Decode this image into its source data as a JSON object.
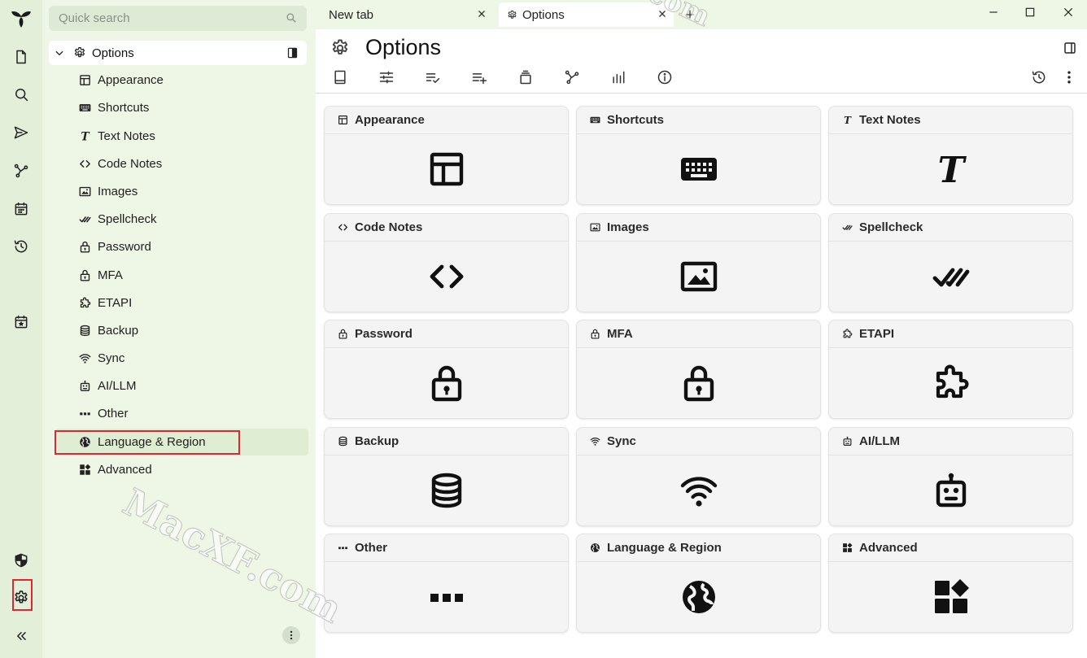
{
  "search": {
    "placeholder": "Quick search"
  },
  "tree": {
    "root_label": "Options",
    "items": [
      {
        "label": "Appearance",
        "icon": "layout-icon"
      },
      {
        "label": "Shortcuts",
        "icon": "keyboard-icon"
      },
      {
        "label": "Text Notes",
        "icon": "text-icon"
      },
      {
        "label": "Code Notes",
        "icon": "code-icon"
      },
      {
        "label": "Images",
        "icon": "image-icon"
      },
      {
        "label": "Spellcheck",
        "icon": "check-double-icon"
      },
      {
        "label": "Password",
        "icon": "lock-icon"
      },
      {
        "label": "MFA",
        "icon": "lock-icon"
      },
      {
        "label": "ETAPI",
        "icon": "puzzle-icon"
      },
      {
        "label": "Backup",
        "icon": "database-icon"
      },
      {
        "label": "Sync",
        "icon": "wifi-icon"
      },
      {
        "label": "AI/LLM",
        "icon": "robot-icon"
      },
      {
        "label": "Other",
        "icon": "dots-icon"
      },
      {
        "label": "Language & Region",
        "icon": "globe-icon"
      },
      {
        "label": "Advanced",
        "icon": "widgets-icon"
      }
    ]
  },
  "tabs": [
    {
      "label": "New tab"
    },
    {
      "label": "Options"
    }
  ],
  "page": {
    "title": "Options"
  },
  "cards": [
    {
      "label": "Appearance",
      "icon": "layout-icon"
    },
    {
      "label": "Shortcuts",
      "icon": "keyboard-icon"
    },
    {
      "label": "Text Notes",
      "icon": "text-icon"
    },
    {
      "label": "Code Notes",
      "icon": "code-icon"
    },
    {
      "label": "Images",
      "icon": "image-icon"
    },
    {
      "label": "Spellcheck",
      "icon": "check-double-icon"
    },
    {
      "label": "Password",
      "icon": "lock-icon"
    },
    {
      "label": "MFA",
      "icon": "lock-icon"
    },
    {
      "label": "ETAPI",
      "icon": "puzzle-icon"
    },
    {
      "label": "Backup",
      "icon": "database-icon"
    },
    {
      "label": "Sync",
      "icon": "wifi-icon"
    },
    {
      "label": "AI/LLM",
      "icon": "robot-icon"
    },
    {
      "label": "Other",
      "icon": "dots-icon"
    },
    {
      "label": "Language & Region",
      "icon": "globe-icon"
    },
    {
      "label": "Advanced",
      "icon": "widgets-icon"
    }
  ],
  "watermark": {
    "main": "MacXF.com",
    "top": "com"
  },
  "colors": {
    "highlight": "#e0262f",
    "sidebar_bg": "#eef7e6",
    "rail_bg": "#e3efd8",
    "selected_row": "#dfeed2"
  }
}
